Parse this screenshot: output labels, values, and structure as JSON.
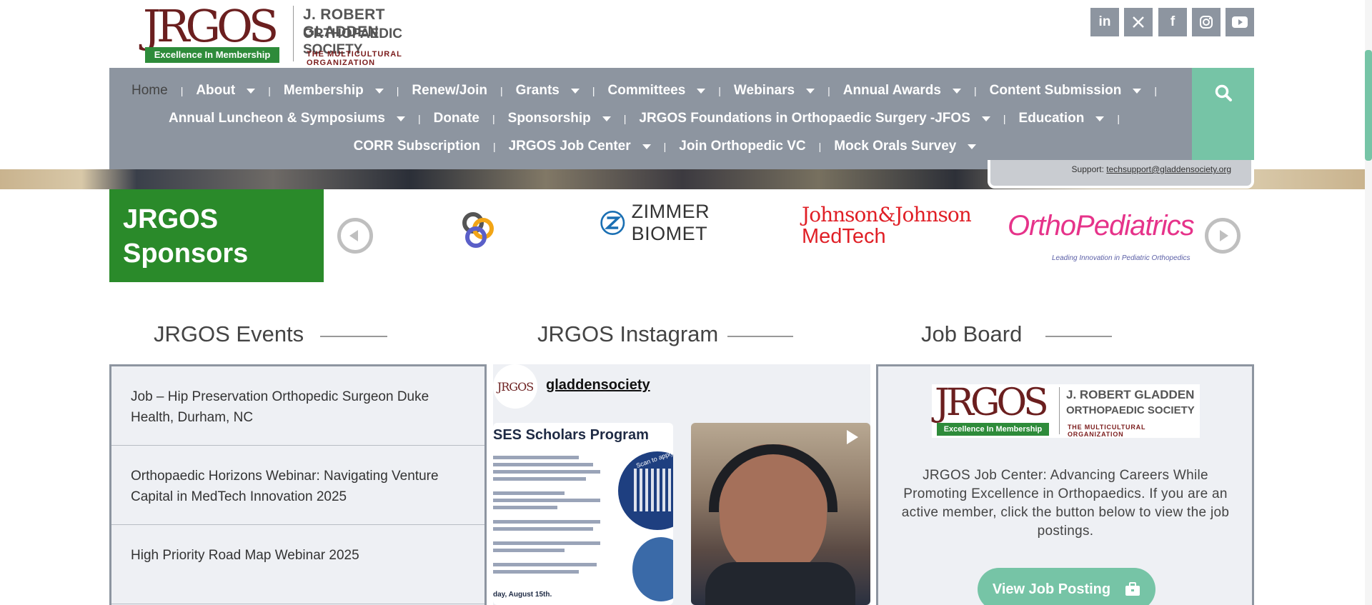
{
  "header": {
    "logo_word": "JRGOS",
    "logo_tagline": "Excellence In Membership",
    "org_name_line1": "J. ROBERT GLADDEN",
    "org_name_line2": "ORTHOPAEDIC SOCIETY",
    "org_subtitle": "THE MULTICULTURAL ORGANIZATION",
    "social": [
      "linkedin-icon",
      "x-icon",
      "facebook-icon",
      "instagram-icon",
      "youtube-icon"
    ]
  },
  "nav": {
    "row1": [
      {
        "label": "Home",
        "dropdown": false,
        "active": true
      },
      {
        "label": "About",
        "dropdown": true
      },
      {
        "label": "Membership",
        "dropdown": true
      },
      {
        "label": "Renew/Join",
        "dropdown": false
      },
      {
        "label": "Grants",
        "dropdown": true
      },
      {
        "label": "Committees",
        "dropdown": true
      },
      {
        "label": "Webinars",
        "dropdown": true
      },
      {
        "label": "Annual Awards",
        "dropdown": true
      },
      {
        "label": "Content Submission",
        "dropdown": true
      }
    ],
    "row2": [
      {
        "label": "Annual Luncheon & Symposiums",
        "dropdown": true
      },
      {
        "label": "Donate",
        "dropdown": false
      },
      {
        "label": "Sponsorship",
        "dropdown": true
      },
      {
        "label": "JRGOS Foundations in Orthopaedic Surgery -JFOS",
        "dropdown": true
      },
      {
        "label": "Education",
        "dropdown": true
      }
    ],
    "row3": [
      {
        "label": "CORR Subscription",
        "dropdown": false
      },
      {
        "label": "JRGOS Job Center",
        "dropdown": true
      },
      {
        "label": "Join Orthopedic VC",
        "dropdown": false
      },
      {
        "label": "Mock Orals Survey",
        "dropdown": true
      }
    ]
  },
  "support": {
    "label": "Support:",
    "email": "techsupport@gladdensociety.org"
  },
  "sponsors": {
    "title_line1": "JRGOS",
    "title_line2": "Sponsors",
    "logos": [
      {
        "name": "c3-logo",
        "text": "C3"
      },
      {
        "name": "zimmer-biomet-logo",
        "text": "ZIMMER BIOMET"
      },
      {
        "name": "johnson-johnson-logo",
        "text_line1": "Johnson&Johnson",
        "text_line2": "MedTech"
      },
      {
        "name": "orthopediatrics-logo",
        "text": "OrthoPediatrics",
        "tagline": "Leading Innovation in Pediatric Orthopedics"
      }
    ]
  },
  "events": {
    "title": "JRGOS Events",
    "items": [
      "Job – Hip Preservation Orthopedic Surgeon Duke Health, Durham, NC",
      "Orthopaedic Horizons Webinar: Navigating Venture Capital in MedTech Innovation 2025",
      "High Priority Road Map Webinar 2025"
    ]
  },
  "instagram": {
    "title": "JRGOS Instagram",
    "handle": "gladdensociety",
    "avatar_text": "JRGOS",
    "post1_title": "SES Scholars Program",
    "post1_badge": "Scan to apply",
    "post1_footer": "day, August 15th."
  },
  "jobs": {
    "title": "Job Board",
    "description": "JRGOS Job Center: Advancing Careers While Promoting Excellence in Orthopaedics. If you are an active member, click the button below to view the job postings.",
    "button_label": "View Job Posting"
  },
  "colors": {
    "nav_bg": "#8d95a0",
    "accent_green": "#76c4a6",
    "sponsor_green": "#2a8a2a",
    "brand_maroon": "#6b1f1f"
  }
}
